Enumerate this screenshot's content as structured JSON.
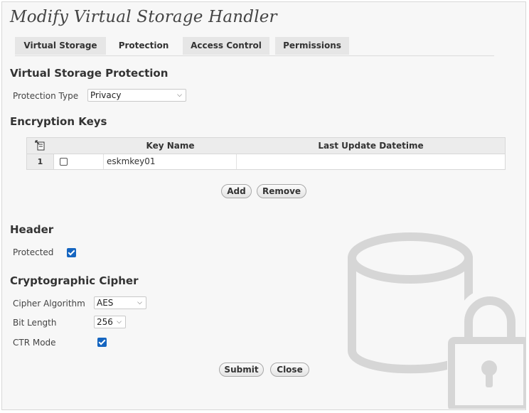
{
  "page": {
    "title": "Modify Virtual Storage Handler"
  },
  "tabs": [
    {
      "label": "Virtual Storage",
      "active": false
    },
    {
      "label": "Protection",
      "active": true
    },
    {
      "label": "Access Control",
      "active": false
    },
    {
      "label": "Permissions",
      "active": false
    }
  ],
  "protection": {
    "heading": "Virtual Storage Protection",
    "type_label": "Protection Type",
    "type_value": "Privacy"
  },
  "keys": {
    "heading": "Encryption Keys",
    "columns": {
      "key_name": "Key Name",
      "last_update": "Last Update Datetime"
    },
    "rows": [
      {
        "index": "1",
        "key_name": "eskmkey01",
        "last_update": "",
        "checked": false
      }
    ],
    "add_label": "Add",
    "remove_label": "Remove"
  },
  "header_section": {
    "heading": "Header",
    "protected_label": "Protected",
    "protected_checked": true
  },
  "cipher": {
    "heading": "Cryptographic Cipher",
    "algorithm_label": "Cipher Algorithm",
    "algorithm_value": "AES",
    "bit_length_label": "Bit Length",
    "bit_length_value": "256",
    "ctr_label": "CTR Mode",
    "ctr_checked": true
  },
  "actions": {
    "submit_label": "Submit",
    "close_label": "Close"
  },
  "icons": {
    "column_chooser": "column-chooser-icon",
    "watermark": "database-lock-icon"
  },
  "colors": {
    "checkbox_accent": "#1565c0",
    "watermark": "#d6d6d6"
  }
}
